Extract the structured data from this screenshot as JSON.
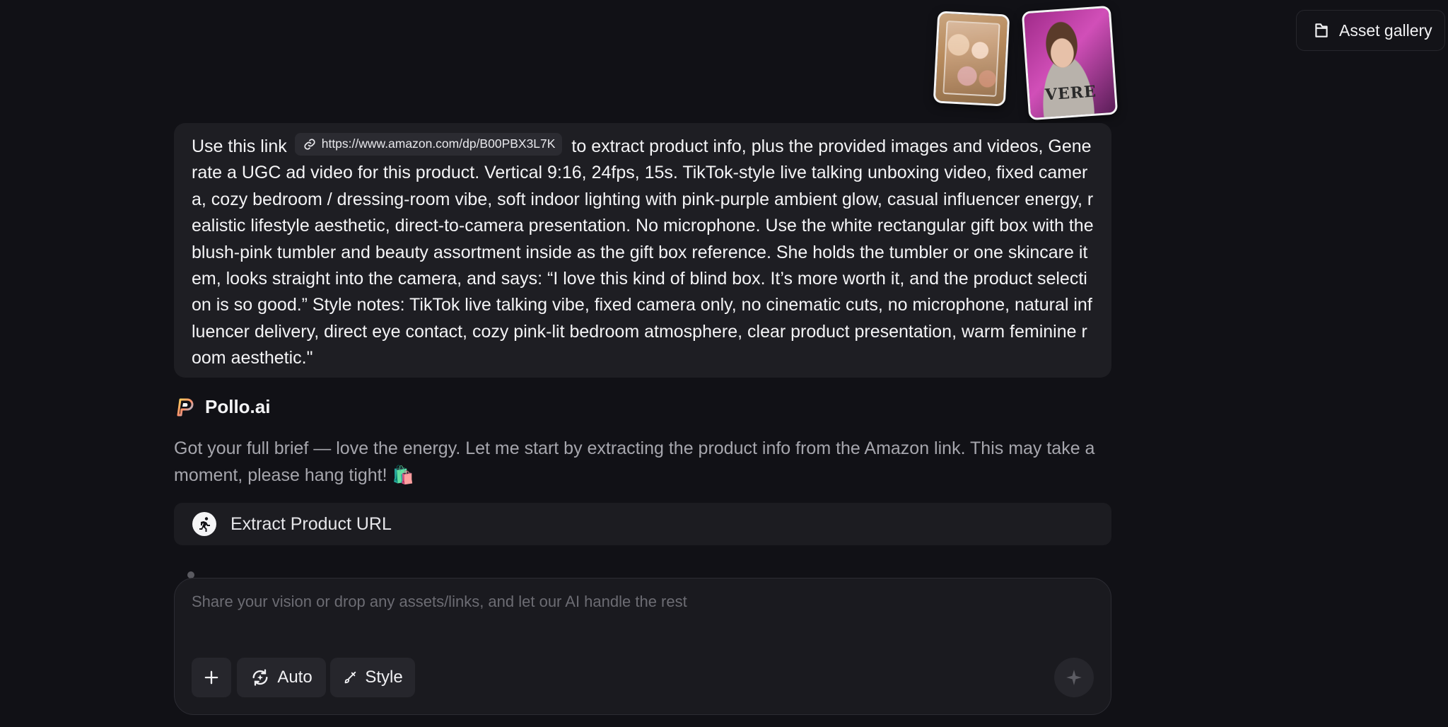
{
  "header": {
    "asset_gallery_label": "Asset gallery",
    "asset_gallery_icon": "folder-icon"
  },
  "attachments": [
    {
      "type": "image",
      "description_icon": "gift-box-thumbnail"
    },
    {
      "type": "image",
      "description_icon": "person-thumbnail",
      "visible_text": "VERE"
    }
  ],
  "user_message": {
    "prefix": "Use this link",
    "link_url": "https://www.amazon.com/dp/B00PBX3L7K",
    "body": "to extract product info, plus the provided images and videos, Generate a UGC ad video for this product. Vertical 9:16, 24fps, 15s. TikTok-style live talking unboxing video, fixed camera, cozy bedroom / dressing-room vibe, soft indoor lighting with pink-purple ambient glow, casual influencer energy, realistic lifestyle aesthetic, direct-to-camera presentation. No microphone. Use the white rectangular gift box with the blush-pink tumbler and beauty assortment inside as the gift box reference. She holds the tumbler or one skincare item, looks straight into the camera, and says: “I love this kind of blind box. It’s more worth it, and the product selection is so good.” Style notes: TikTok live talking vibe, fixed camera only, no cinematic cuts, no microphone, natural influencer delivery, direct eye contact, cozy pink-lit bedroom atmosphere, clear product presentation, warm feminine room aesthetic.\""
  },
  "bot": {
    "name": "Pollo.ai",
    "message": "Got your full brief — love the energy. Let me start by extracting the product info from the Amazon link. This may take a moment, please hang tight! 🛍️",
    "tool_label": "Extract Product URL"
  },
  "composer": {
    "placeholder": "Share your vision or drop any assets/links, and let our AI handle the rest",
    "auto_label": "Auto",
    "style_label": "Style"
  },
  "colors": {
    "background": "#111116",
    "bubble": "#1e1e23",
    "muted_text": "#a6a6ad"
  }
}
